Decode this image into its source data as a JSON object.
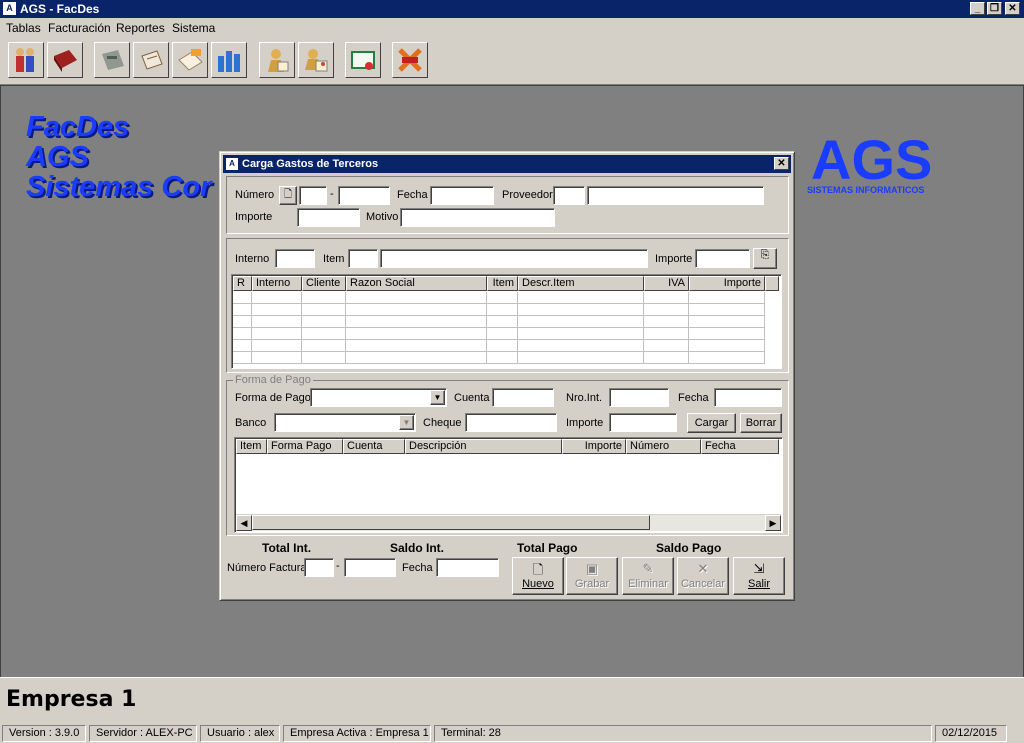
{
  "window": {
    "title": "AGS - FacDes",
    "controls": [
      "_",
      "❒",
      "✕"
    ]
  },
  "menu": [
    "Tablas",
    "Facturación",
    "Reportes",
    "Sistema"
  ],
  "toolbar_icons": [
    "users-icon",
    "book-icon",
    "calculator-icon",
    "invoice-icon",
    "mail-icon",
    "bar-chart-icon",
    "person-document-icon",
    "persons-document-icon",
    "certificate-icon",
    "exit-icon"
  ],
  "brand": {
    "line1": "FacDes",
    "line2": "AGS",
    "line3": "Sistemas Cor",
    "logo": "AGS",
    "logo_sub": "SISTEMAS INFORMATICOS"
  },
  "dialog": {
    "title": "Carga Gastos de Terceros",
    "header": {
      "numero_label": "Número",
      "fecha_label": "Fecha",
      "proveedor_label": "Proveedor",
      "importe_label": "Importe",
      "motivo_label": "Motivo",
      "dash": "-"
    },
    "items": {
      "interno_label": "Interno",
      "item_label": "Item",
      "importe_label": "Importe",
      "columns": [
        "R",
        "Interno",
        "Cliente",
        "Razon Social",
        "Item",
        "Descr.Item",
        "IVA",
        "Importe"
      ]
    },
    "pago": {
      "group_label": "Forma de Pago",
      "forma_label": "Forma de Pago",
      "cuenta_label": "Cuenta",
      "nroint_label": "Nro.Int.",
      "fecha_label": "Fecha",
      "banco_label": "Banco",
      "cheque_label": "Cheque",
      "importe_label": "Importe",
      "cargar": "Cargar",
      "borrar": "Borrar",
      "columns": [
        "Item",
        "Forma Pago",
        "Cuenta",
        "Descripción",
        "Importe",
        "Número",
        "Fecha"
      ]
    },
    "totals": {
      "total_int": "Total Int.",
      "saldo_int": "Saldo Int.",
      "total_pago": "Total Pago",
      "saldo_pago": "Saldo Pago",
      "numero_factura_label": "Número Factura",
      "fecha_label": "Fecha",
      "dash": "-"
    },
    "buttons": {
      "nuevo": "Nuevo",
      "grabar": "Grabar",
      "eliminar": "Eliminar",
      "cancelar": "Cancelar",
      "salir": "Salir"
    }
  },
  "empresa": "Empresa 1",
  "status": {
    "version": "Version : 3.9.0",
    "servidor": "Servidor : ALEX-PC",
    "usuario": "Usuario : alex",
    "empresa": "Empresa Activa : Empresa 1",
    "terminal": "Terminal: 28",
    "date": "02/12/2015"
  },
  "colors": {
    "titlebar": "#0a246a",
    "brand": "#1a3cff",
    "workspace": "#808080",
    "face": "#d4d0c8"
  }
}
